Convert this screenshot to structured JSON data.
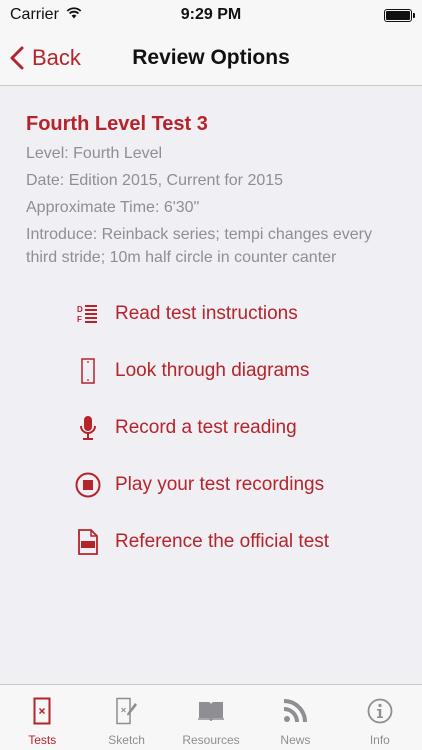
{
  "status_bar": {
    "carrier": "Carrier",
    "time": "9:29 PM"
  },
  "nav": {
    "back_label": "Back",
    "title": "Review Options"
  },
  "test": {
    "title": "Fourth Level Test 3",
    "level": "Level:  Fourth Level",
    "date": "Date:  Edition 2015, Current for 2015",
    "time": "Approximate Time:  6'30\"",
    "introduce": "Introduce: Reinback series; tempi changes every third stride; 10m half circle in counter canter"
  },
  "actions": [
    {
      "label": "Read test instructions",
      "icon": "document-list-icon"
    },
    {
      "label": "Look through diagrams",
      "icon": "arena-diagram-icon"
    },
    {
      "label": "Record a test reading",
      "icon": "microphone-icon"
    },
    {
      "label": "Play your test recordings",
      "icon": "play-recording-icon"
    },
    {
      "label": "Reference the official test",
      "icon": "pdf-file-icon"
    }
  ],
  "tabs": [
    {
      "label": "Tests",
      "icon": "test-sheet-icon",
      "active": true
    },
    {
      "label": "Sketch",
      "icon": "sketch-icon",
      "active": false
    },
    {
      "label": "Resources",
      "icon": "book-icon",
      "active": false
    },
    {
      "label": "News",
      "icon": "rss-icon",
      "active": false
    },
    {
      "label": "Info",
      "icon": "info-icon",
      "active": false
    }
  ],
  "colors": {
    "accent": "#b5242b",
    "secondary_text": "#8e8e93",
    "background": "#efeff4",
    "bar": "#f7f7f7"
  }
}
